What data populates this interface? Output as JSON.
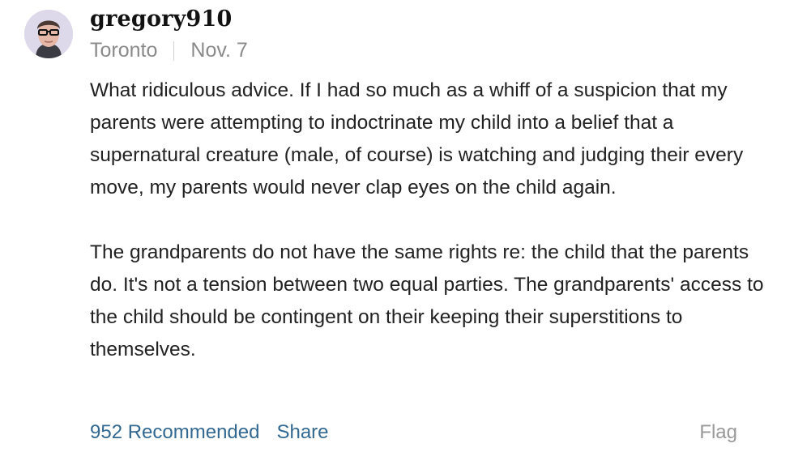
{
  "comment": {
    "username": "gregory910",
    "location": "Toronto",
    "date": "Nov. 7",
    "paragraphs": [
      "What ridiculous advice. If I had so much as a whiff of a suspicion that my parents were attempting to indoctrinate my child into a belief that a supernatural creature (male, of course) is watching and judging their every move, my parents would never clap eyes on the child again.",
      "The grandparents do not have the same rights re: the child that the parents do. It's not a tension between two equal parties. The grandparents' access to the child should be contingent on their keeping their superstitions to themselves."
    ],
    "recommended_label": "952 Recommended",
    "share_label": "Share",
    "flag_label": "Flag"
  },
  "colors": {
    "link": "#326891",
    "meta": "#8a8a8a",
    "text": "#222222",
    "flag": "#999999"
  },
  "icons": {
    "avatar": "user-photo-avatar"
  }
}
